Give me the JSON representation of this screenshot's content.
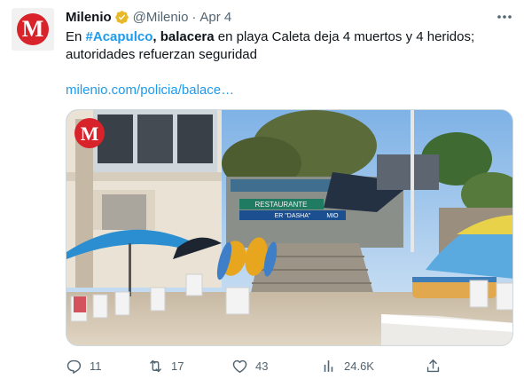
{
  "tweet": {
    "author_name": "Milenio",
    "avatar_letter": "M",
    "handle": "@Milenio",
    "separator": "·",
    "date": "Apr 4",
    "text": {
      "prefix": "En ",
      "hashtag": "#Acapulco",
      "comma": ",",
      "bold_word": "balacera",
      "rest": " en playa Caleta deja 4 muertos y 4 heridos; autoridades refuerzan seguridad"
    },
    "link_text": "milenio.com/policia/balace…",
    "media": {
      "watermark_letter": "M",
      "sign_text": "RESTAURANTE",
      "sign_sub": "ER \"DASHA\"",
      "sign_right": "MIO"
    }
  },
  "actions": {
    "replies": "11",
    "retweets": "17",
    "likes": "43",
    "views": "24.6K"
  },
  "icons": {
    "verified": "verified-badge-icon",
    "more": "more-dots-icon",
    "reply": "reply-icon",
    "retweet": "retweet-icon",
    "like": "heart-icon",
    "views": "views-icon",
    "share": "share-icon"
  },
  "colors": {
    "link": "#1d9bf0",
    "muted": "#536471",
    "brand_red": "#d8232a",
    "verified_gold": "#e8b829"
  }
}
